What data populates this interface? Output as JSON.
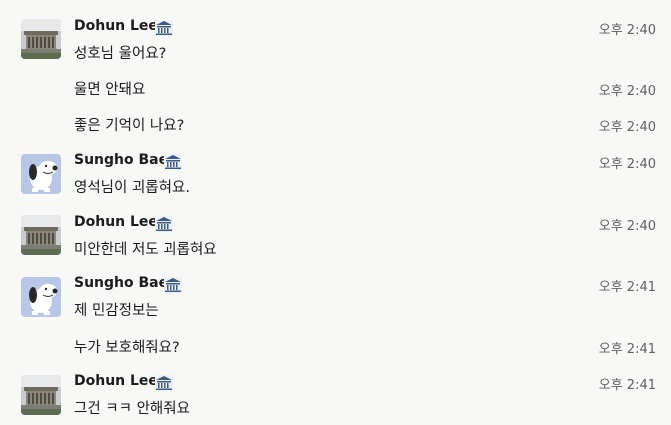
{
  "messages": [
    {
      "sender": "Dohun Lee",
      "avatar": "building-avatar",
      "text": "성호님 울어요?",
      "time": "오후 2:40"
    },
    {
      "sender": null,
      "text": "울면 안돼요",
      "time": "오후 2:40"
    },
    {
      "sender": null,
      "text": "좋은 기억이 나요?",
      "time": "오후 2:40"
    },
    {
      "sender": "Sungho Bae",
      "avatar": "snoopy-avatar",
      "text": "영석님이 괴롭혀요.",
      "time": "오후 2:40"
    },
    {
      "sender": "Dohun Lee",
      "avatar": "building-avatar",
      "text": "미안한데 저도 괴롭혀요",
      "time": "오후 2:40"
    },
    {
      "sender": "Sungho Bae",
      "avatar": "snoopy-avatar",
      "text": "제 민감정보는",
      "time": "오후 2:41"
    },
    {
      "sender": null,
      "text": "누가 보호해줘요?",
      "time": "오후 2:41"
    },
    {
      "sender": "Dohun Lee",
      "avatar": "building-avatar",
      "text": "그건 ㅋㅋ 안해줘요",
      "time": "오후 2:41"
    }
  ],
  "icons": {
    "sender_badge": "government-building-icon"
  },
  "colors": {
    "background": "#f8f8f6",
    "text": "#1d1c1d",
    "timestamp": "#616061"
  }
}
